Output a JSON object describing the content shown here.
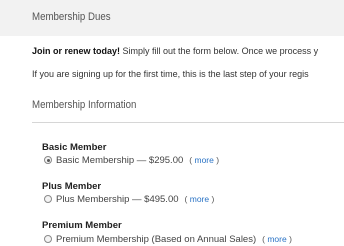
{
  "header": {
    "title": "Membership Dues"
  },
  "intro": {
    "bold": "Join or renew today!",
    "rest": " Simply fill out the form below. Once we process y",
    "line2": "If you are signing up for the first time, this is the last step of your regis"
  },
  "section": {
    "title": "Membership Information"
  },
  "groups": [
    {
      "label": "Basic Member",
      "option": "Basic Membership — $295.00",
      "checked": true,
      "more_open": "(",
      "more_link": "more",
      "more_close": ")"
    },
    {
      "label": "Plus Member",
      "option": "Plus Membership — $495.00",
      "checked": false,
      "more_open": "(",
      "more_link": "more",
      "more_close": ")"
    },
    {
      "label": "Premium Member",
      "option": "Premium Membership (Based on Annual Sales)",
      "checked": false,
      "more_open": "(",
      "more_link": "more",
      "more_close": ")"
    }
  ],
  "colors": {
    "link": "#2a73c5",
    "header_bg": "#f2f2f2"
  }
}
